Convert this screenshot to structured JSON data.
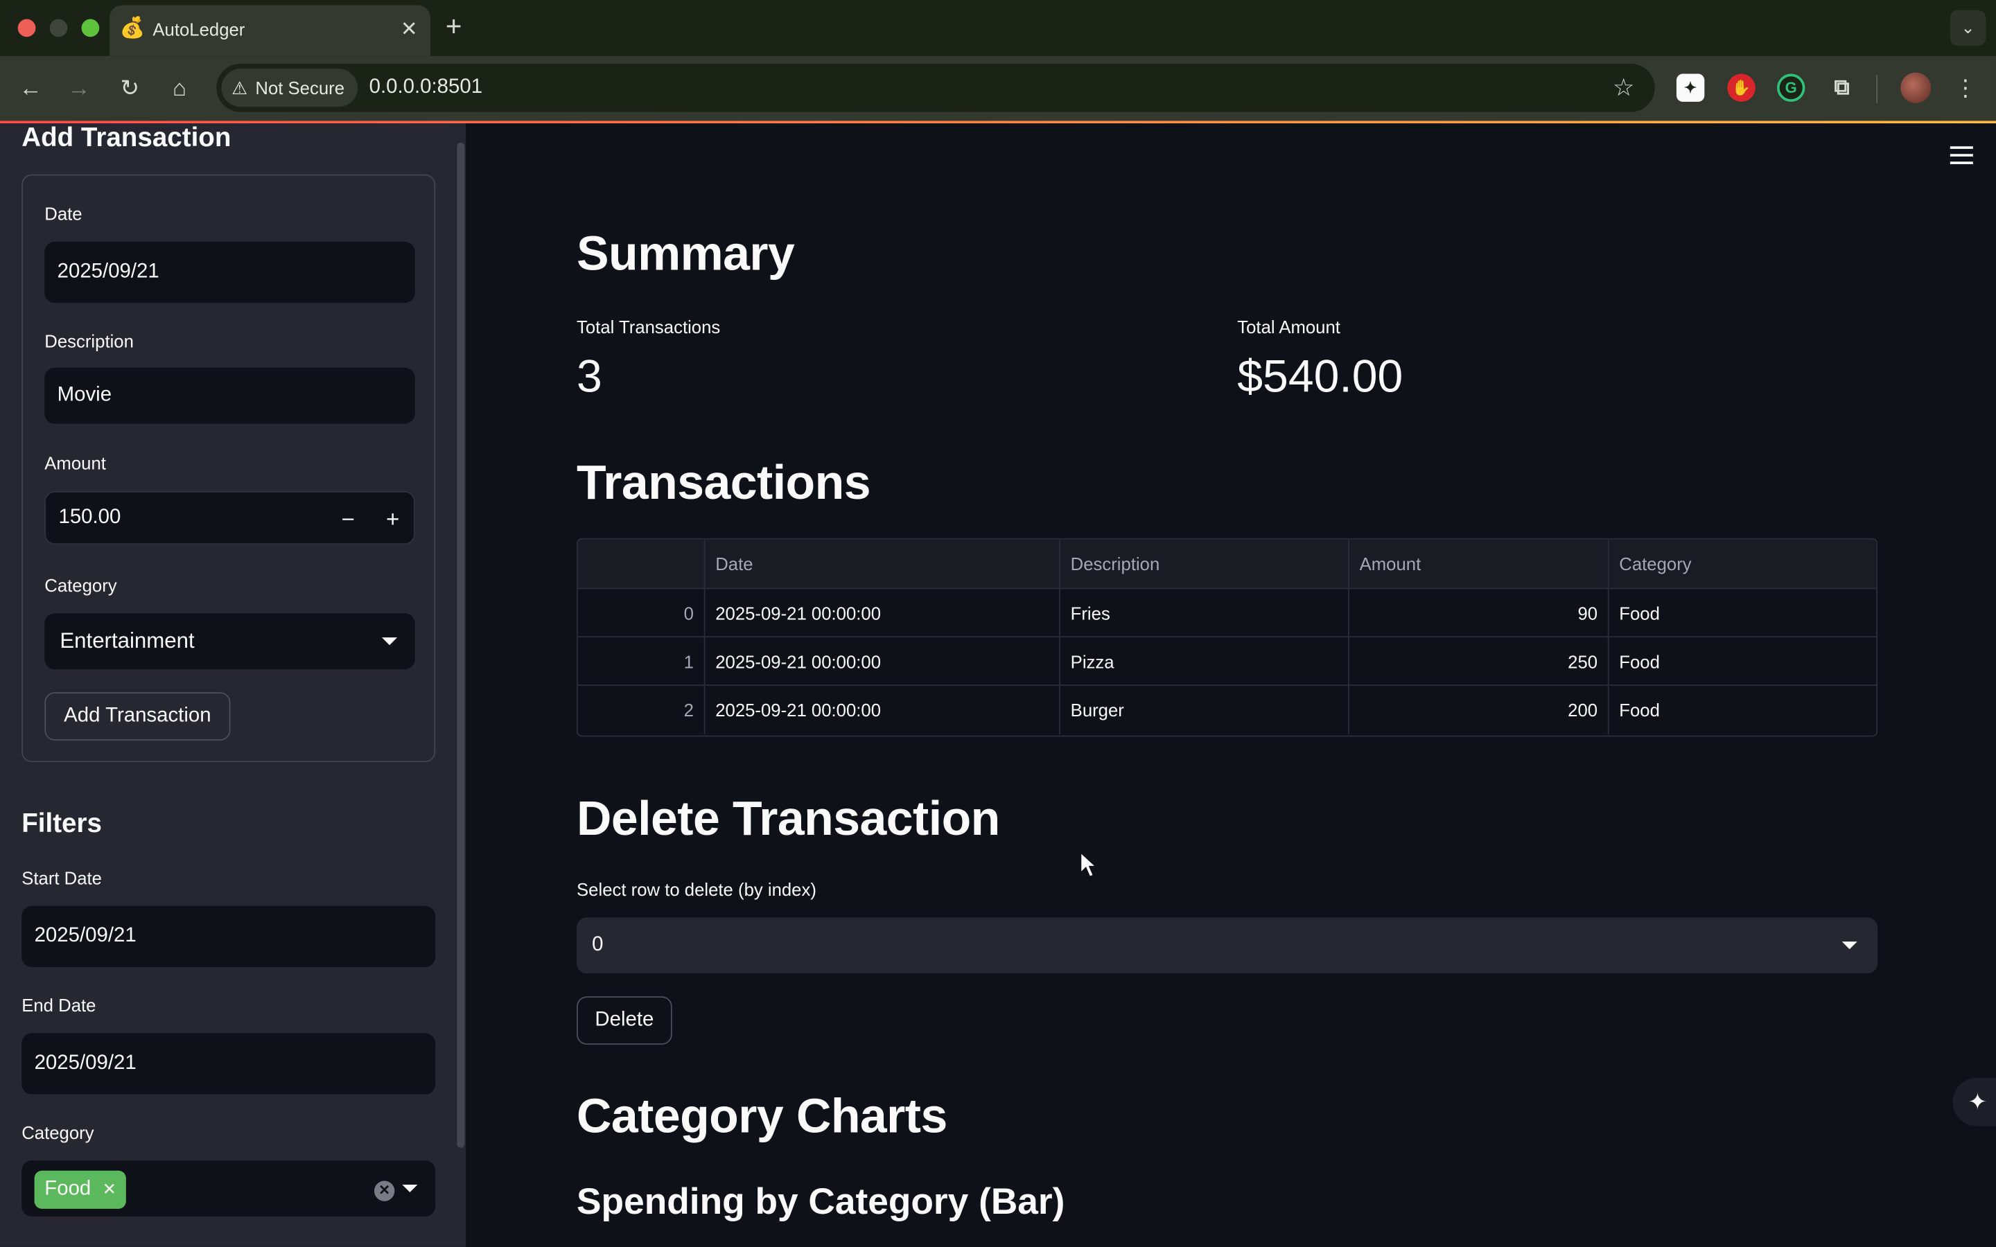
{
  "browser": {
    "tab_title": "AutoLedger",
    "tab_favicon": "money-bag-icon",
    "security_label": "Not Secure",
    "url": "0.0.0.0:8501"
  },
  "sidebar": {
    "add_title": "Add Transaction",
    "date_label": "Date",
    "date_value": "2025/09/21",
    "description_label": "Description",
    "description_value": "Movie",
    "amount_label": "Amount",
    "amount_value": "150.00",
    "category_label": "Category",
    "category_value": "Entertainment",
    "add_button": "Add Transaction",
    "filters_title": "Filters",
    "start_label": "Start Date",
    "start_value": "2025/09/21",
    "end_label": "End Date",
    "end_value": "2025/09/21",
    "filter_category_label": "Category",
    "filter_tag": "Food"
  },
  "summary": {
    "title": "Summary",
    "total_tx_label": "Total Transactions",
    "total_tx_value": "3",
    "total_amount_label": "Total Amount",
    "total_amount_value": "$540.00"
  },
  "transactions": {
    "title": "Transactions",
    "columns": [
      "",
      "Date",
      "Description",
      "Amount",
      "Category"
    ],
    "rows": [
      {
        "index": "0",
        "date": "2025-09-21 00:00:00",
        "description": "Fries",
        "amount": "90",
        "category": "Food"
      },
      {
        "index": "1",
        "date": "2025-09-21 00:00:00",
        "description": "Pizza",
        "amount": "250",
        "category": "Food"
      },
      {
        "index": "2",
        "date": "2025-09-21 00:00:00",
        "description": "Burger",
        "amount": "200",
        "category": "Food"
      }
    ]
  },
  "delete": {
    "title": "Delete Transaction",
    "select_label": "Select row to delete (by index)",
    "select_value": "0",
    "button": "Delete"
  },
  "charts": {
    "title": "Category Charts",
    "bar_subtitle": "Spending by Category (Bar)"
  },
  "colors": {
    "accent_loadbar": "#ff4b4b",
    "tag_green": "#5cb85c",
    "background": "#0e1117",
    "sidebar": "#262730"
  }
}
